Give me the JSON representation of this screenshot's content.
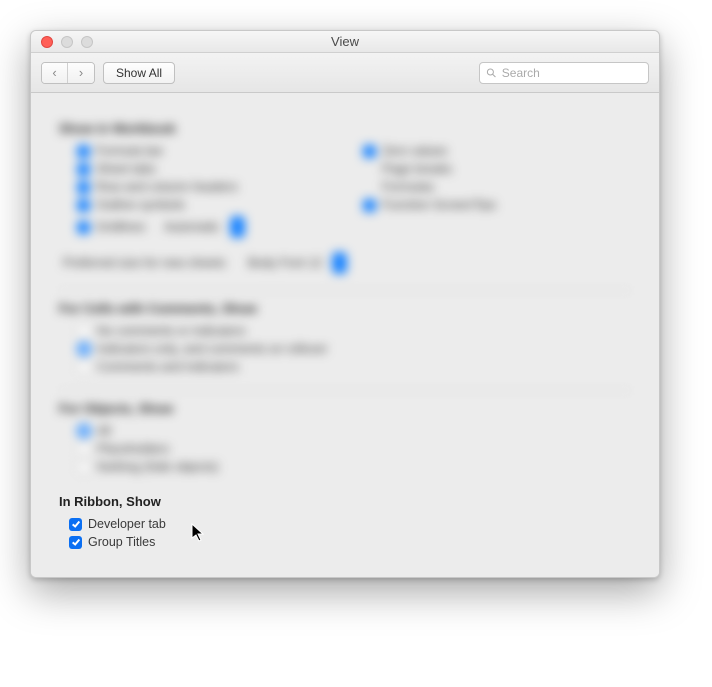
{
  "window": {
    "title": "View"
  },
  "toolbar": {
    "show_all": "Show All",
    "search_placeholder": "Search"
  },
  "blurred_sections": {
    "s1": {
      "title": "Show in Workbook",
      "left": [
        "Formula bar",
        "Sheet tabs",
        "Row and column headers",
        "Outline symbols",
        "Gridlines",
        "Automatic"
      ],
      "right": [
        "Zero values",
        "Page breaks",
        "Formulas",
        "Function ScreenTips"
      ],
      "font_row_label": "Preferred size for new sheets",
      "font_row_value": "Body Font   12"
    },
    "s2": {
      "title": "For Cells with Comments, Show",
      "opts": [
        "No comments or indicators",
        "Indicators only, and comments on rollover",
        "Comments and indicators"
      ]
    },
    "s3": {
      "title": "For Objects, Show",
      "opts": [
        "All",
        "Placeholders",
        "Nothing (hide objects)"
      ]
    }
  },
  "ribbon": {
    "title": "In Ribbon, Show",
    "dev": "Developer tab",
    "groups": "Group Titles"
  }
}
